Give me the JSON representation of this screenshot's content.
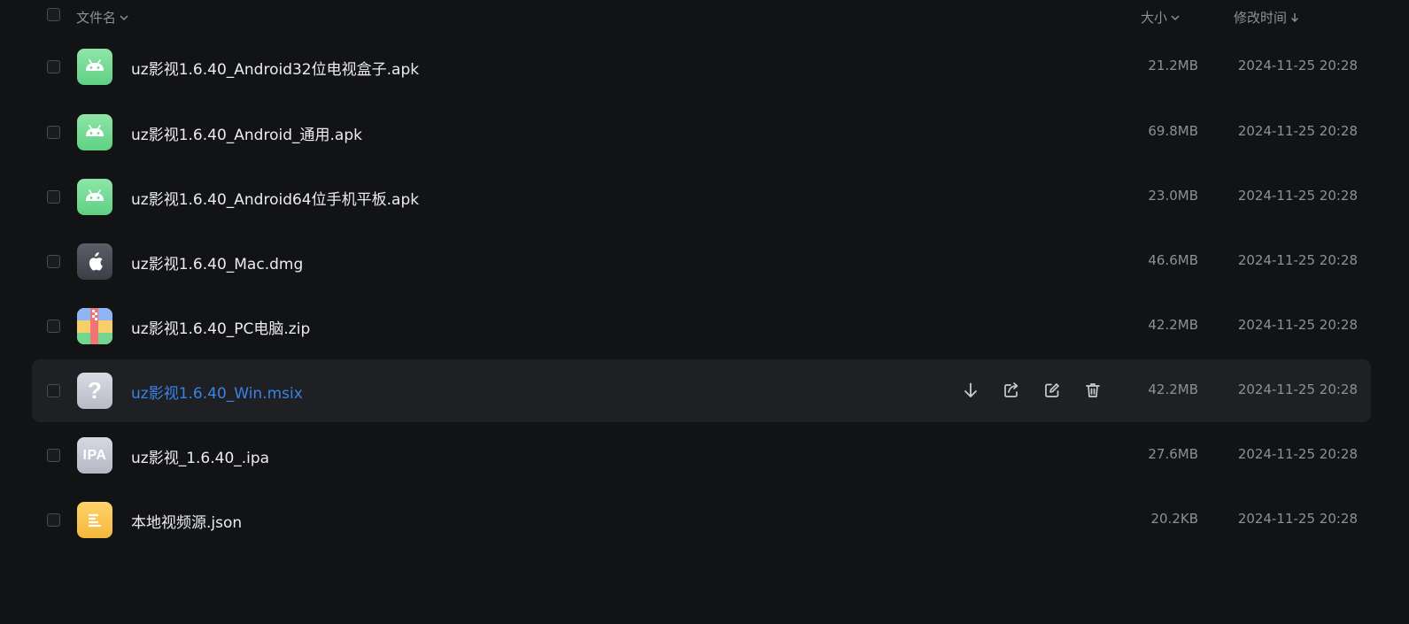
{
  "header": {
    "name_label": "文件名",
    "size_label": "大小",
    "time_label": "修改时间"
  },
  "files": [
    {
      "name": "uz影视1.6.40_Android32位电视盒子.apk",
      "size": "21.2MB",
      "time": "2024-11-25 20:28",
      "icon": "android-icon"
    },
    {
      "name": "uz影视1.6.40_Android_通用.apk",
      "size": "69.8MB",
      "time": "2024-11-25 20:28",
      "icon": "android-icon"
    },
    {
      "name": "uz影视1.6.40_Android64位手机平板.apk",
      "size": "23.0MB",
      "time": "2024-11-25 20:28",
      "icon": "android-icon"
    },
    {
      "name": "uz影视1.6.40_Mac.dmg",
      "size": "46.6MB",
      "time": "2024-11-25 20:28",
      "icon": "apple-icon"
    },
    {
      "name": "uz影视1.6.40_PC电脑.zip",
      "size": "42.2MB",
      "time": "2024-11-25 20:28",
      "icon": "zip-archive-icon"
    },
    {
      "name": "uz影视1.6.40_Win.msix",
      "size": "42.2MB",
      "time": "2024-11-25 20:28",
      "icon": "unknown-file-icon",
      "hovered": true
    },
    {
      "name": "uz影视_1.6.40_.ipa",
      "size": "27.6MB",
      "time": "2024-11-25 20:28",
      "icon": "ipa-file-icon",
      "icon_text": "IPA"
    },
    {
      "name": "本地视频源.json",
      "size": "20.2KB",
      "time": "2024-11-25 20:28",
      "icon": "text-file-icon"
    }
  ],
  "unknown_icon_text": "?",
  "row_actions": [
    "download-icon",
    "share-icon",
    "rename-icon",
    "delete-icon"
  ],
  "colors": {
    "background": "#121315",
    "hover_row": "#1f2023",
    "link_blue": "#3a82e6",
    "muted_text": "#8e9097",
    "android_green": "#6fd88f",
    "json_yellow": "#f8c14a"
  }
}
